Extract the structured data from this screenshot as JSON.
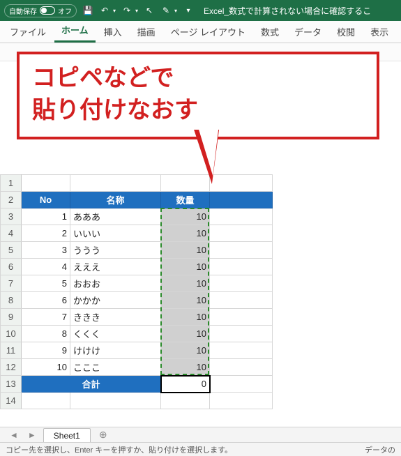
{
  "titlebar": {
    "autosave_label": "自動保存",
    "autosave_state": "オフ",
    "doc_title": "Excel_数式で計算されない場合に確認するこ"
  },
  "ribbon": {
    "tabs": [
      "ファイル",
      "ホーム",
      "挿入",
      "描画",
      "ページ レイアウト",
      "数式",
      "データ",
      "校閲",
      "表示"
    ],
    "active_index": 1
  },
  "callout": {
    "text": "コピペなどで\n貼り付けなおす"
  },
  "row_numbers": [
    1,
    2,
    3,
    4,
    5,
    6,
    7,
    8,
    9,
    10,
    11,
    12,
    13,
    14
  ],
  "table": {
    "headers": {
      "no": "No",
      "name": "名称",
      "qty": "数量"
    },
    "rows": [
      {
        "no": 1,
        "name": "あああ",
        "qty": 10
      },
      {
        "no": 2,
        "name": "いいい",
        "qty": 10
      },
      {
        "no": 3,
        "name": "ううう",
        "qty": 10
      },
      {
        "no": 4,
        "name": "えええ",
        "qty": 10
      },
      {
        "no": 5,
        "name": "おおお",
        "qty": 10
      },
      {
        "no": 6,
        "name": "かかか",
        "qty": 10
      },
      {
        "no": 7,
        "name": "ききき",
        "qty": 10
      },
      {
        "no": 8,
        "name": "くくく",
        "qty": 10
      },
      {
        "no": 9,
        "name": "けけけ",
        "qty": 10
      },
      {
        "no": 10,
        "name": "こここ",
        "qty": 10
      }
    ],
    "total_label": "合計",
    "total_value": 0
  },
  "sheet_tab": {
    "name": "Sheet1"
  },
  "statusbar": {
    "left": "コピー先を選択し、Enter キーを押すか、貼り付けを選択します。",
    "right": "データの"
  }
}
